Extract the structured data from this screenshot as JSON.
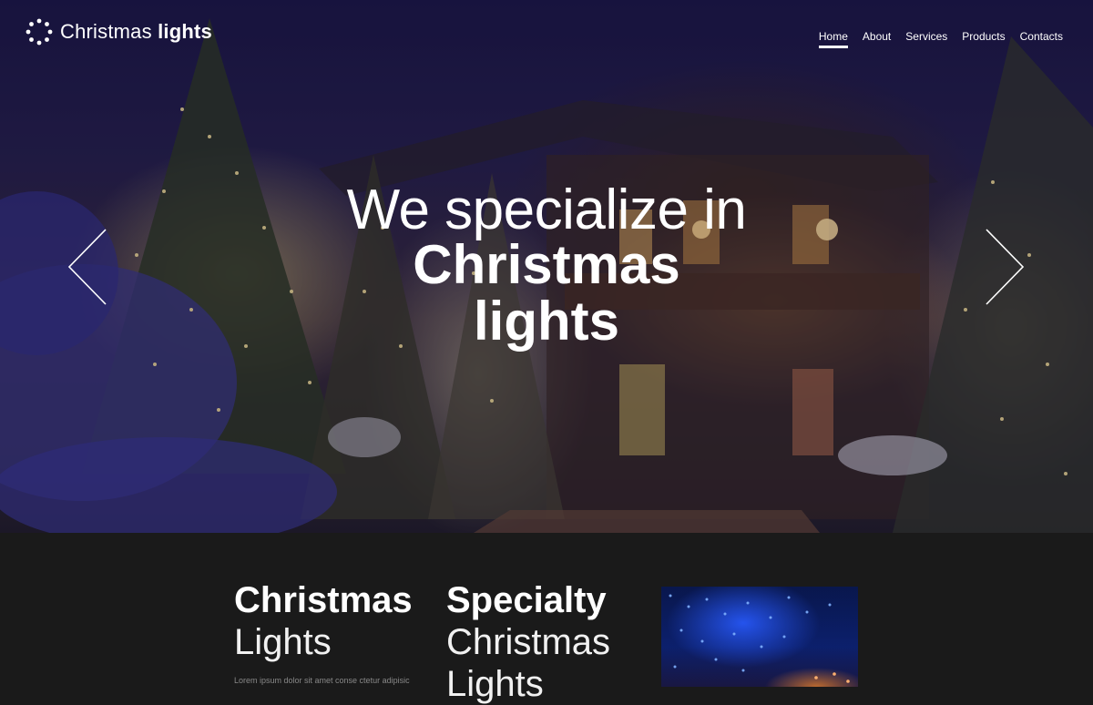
{
  "brand": {
    "name_light": "Christmas",
    "name_bold": "lights"
  },
  "nav": {
    "items": [
      {
        "label": "Home",
        "active": true
      },
      {
        "label": "About",
        "active": false
      },
      {
        "label": "Services",
        "active": false
      },
      {
        "label": "Products",
        "active": false
      },
      {
        "label": "Contacts",
        "active": false
      }
    ]
  },
  "hero": {
    "line1": "We specialize in",
    "line2": "Christmas",
    "line3": "lights",
    "prev_icon": "chevron-left-icon",
    "next_icon": "chevron-right-icon"
  },
  "section": {
    "col1": {
      "title": "Christmas",
      "subtitle": "Lights"
    },
    "col2": {
      "title": "Specialty",
      "subtitle": "Christmas",
      "subtitle2": "Lights"
    },
    "col1_text": "Lorem ipsum dolor sit amet conse ctetur adipisic",
    "image_icon": "christmas-lights-photo"
  }
}
